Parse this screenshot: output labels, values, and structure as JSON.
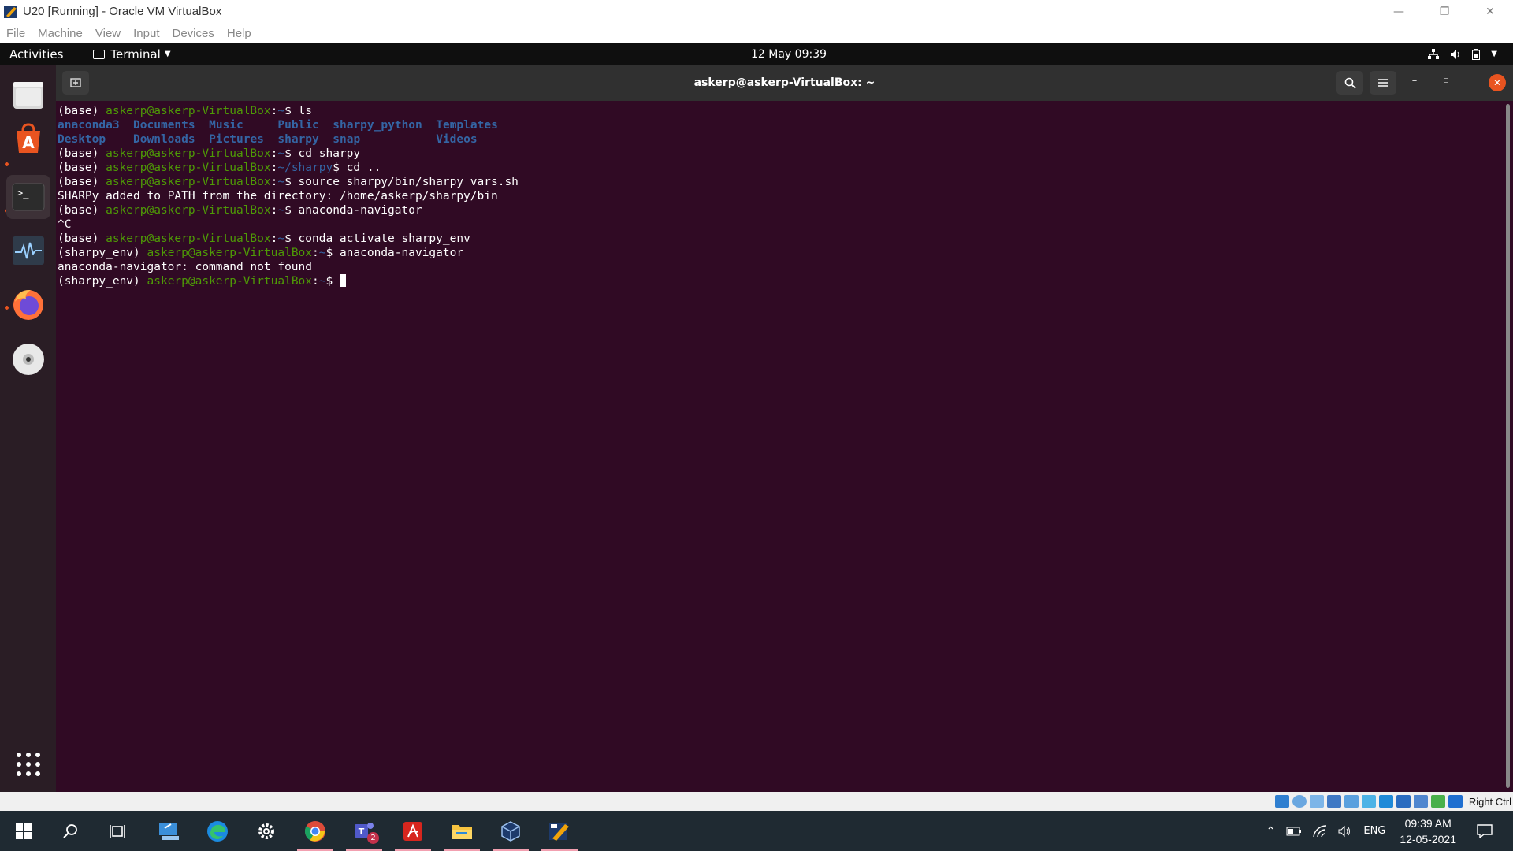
{
  "host": {
    "window_title": "U20 [Running] - Oracle VM VirtualBox",
    "menu": [
      "File",
      "Machine",
      "View",
      "Input",
      "Devices",
      "Help"
    ],
    "host_key_label": "Right Ctrl"
  },
  "gnome": {
    "activities": "Activities",
    "app_menu": "Terminal",
    "clock": "12 May  09:39"
  },
  "dock": {
    "items": [
      "files",
      "ubuntu-software",
      "terminal",
      "system-monitor",
      "firefox",
      "disc"
    ]
  },
  "terminal": {
    "title": "askerp@askerp-VirtualBox: ~",
    "lines": [
      [
        {
          "t": "(base) ",
          "c": ""
        },
        {
          "t": "askerp@askerp-VirtualBox",
          "c": "c-green"
        },
        {
          "t": ":",
          "c": ""
        },
        {
          "t": "~",
          "c": "c-blue"
        },
        {
          "t": "$ ls",
          "c": ""
        }
      ],
      [
        {
          "t": "anaconda3",
          "c": "c-dir"
        },
        {
          "t": "  ",
          "c": ""
        },
        {
          "t": "Documents",
          "c": "c-dir"
        },
        {
          "t": "  ",
          "c": ""
        },
        {
          "t": "Music",
          "c": "c-dir"
        },
        {
          "t": "     ",
          "c": ""
        },
        {
          "t": "Public",
          "c": "c-dir"
        },
        {
          "t": "  ",
          "c": ""
        },
        {
          "t": "sharpy_python",
          "c": "c-dir"
        },
        {
          "t": "  ",
          "c": ""
        },
        {
          "t": "Templates",
          "c": "c-dir"
        }
      ],
      [
        {
          "t": "Desktop",
          "c": "c-dir"
        },
        {
          "t": "    ",
          "c": ""
        },
        {
          "t": "Downloads",
          "c": "c-dir"
        },
        {
          "t": "  ",
          "c": ""
        },
        {
          "t": "Pictures",
          "c": "c-dir"
        },
        {
          "t": "  ",
          "c": ""
        },
        {
          "t": "sharpy",
          "c": "c-dir"
        },
        {
          "t": "  ",
          "c": ""
        },
        {
          "t": "snap",
          "c": "c-dir"
        },
        {
          "t": "           ",
          "c": ""
        },
        {
          "t": "Videos",
          "c": "c-dir"
        }
      ],
      [
        {
          "t": "(base) ",
          "c": ""
        },
        {
          "t": "askerp@askerp-VirtualBox",
          "c": "c-green"
        },
        {
          "t": ":",
          "c": ""
        },
        {
          "t": "~",
          "c": "c-blue"
        },
        {
          "t": "$ cd sharpy",
          "c": ""
        }
      ],
      [
        {
          "t": "(base) ",
          "c": ""
        },
        {
          "t": "askerp@askerp-VirtualBox",
          "c": "c-green"
        },
        {
          "t": ":",
          "c": ""
        },
        {
          "t": "~/sharpy",
          "c": "c-blue"
        },
        {
          "t": "$ cd ..",
          "c": ""
        }
      ],
      [
        {
          "t": "(base) ",
          "c": ""
        },
        {
          "t": "askerp@askerp-VirtualBox",
          "c": "c-green"
        },
        {
          "t": ":",
          "c": ""
        },
        {
          "t": "~",
          "c": "c-blue"
        },
        {
          "t": "$ source sharpy/bin/sharpy_vars.sh",
          "c": ""
        }
      ],
      [
        {
          "t": "SHARPy added to PATH from the directory: /home/askerp/sharpy/bin",
          "c": ""
        }
      ],
      [
        {
          "t": "(base) ",
          "c": ""
        },
        {
          "t": "askerp@askerp-VirtualBox",
          "c": "c-green"
        },
        {
          "t": ":",
          "c": ""
        },
        {
          "t": "~",
          "c": "c-blue"
        },
        {
          "t": "$ anaconda-navigator",
          "c": ""
        }
      ],
      [
        {
          "t": "^C",
          "c": ""
        }
      ],
      [
        {
          "t": "(base) ",
          "c": ""
        },
        {
          "t": "askerp@askerp-VirtualBox",
          "c": "c-green"
        },
        {
          "t": ":",
          "c": ""
        },
        {
          "t": "~",
          "c": "c-blue"
        },
        {
          "t": "$ conda activate sharpy_env",
          "c": ""
        }
      ],
      [
        {
          "t": "(sharpy_env) ",
          "c": ""
        },
        {
          "t": "askerp@askerp-VirtualBox",
          "c": "c-green"
        },
        {
          "t": ":",
          "c": ""
        },
        {
          "t": "~",
          "c": "c-blue"
        },
        {
          "t": "$ anaconda-navigator",
          "c": ""
        }
      ],
      [
        {
          "t": "anaconda-navigator: command not found",
          "c": ""
        }
      ],
      [
        {
          "t": "(sharpy_env) ",
          "c": ""
        },
        {
          "t": "askerp@askerp-VirtualBox",
          "c": "c-green"
        },
        {
          "t": ":",
          "c": ""
        },
        {
          "t": "~",
          "c": "c-blue"
        },
        {
          "t": "$ ",
          "c": ""
        }
      ]
    ]
  },
  "taskbar": {
    "apps": [
      "start",
      "search",
      "task-view",
      "vm-app",
      "edge",
      "settings",
      "chrome",
      "teams",
      "acrobat",
      "file-explorer",
      "virtualbox",
      "virtualbox-vm"
    ],
    "teams_badge": "2",
    "language": "ENG",
    "time": "09:39 AM",
    "date": "12-05-2021"
  },
  "colors": {
    "terminal_bg": "#300a24",
    "prompt_green": "#4e9a06",
    "path_blue": "#3465a4",
    "ubuntu_orange": "#e95420"
  }
}
